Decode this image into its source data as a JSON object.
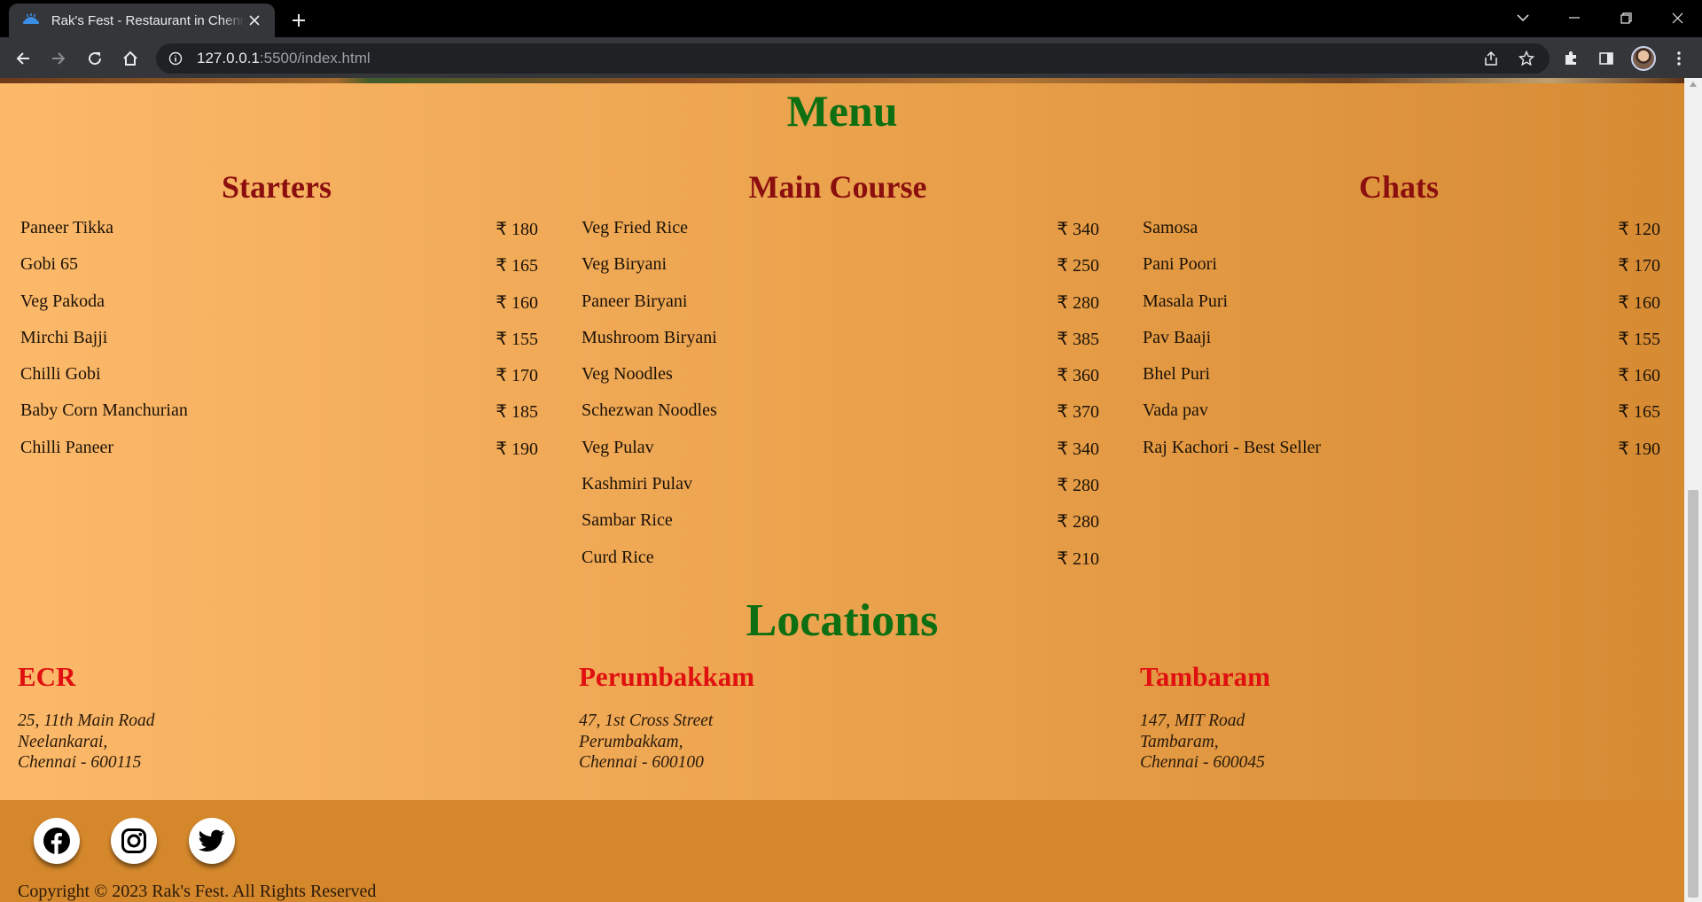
{
  "browser": {
    "tab_title": "Rak's Fest - Restaurant in Chennai",
    "url_host": "127.0.0.1",
    "url_rest": ":5500/index.html"
  },
  "menu": {
    "title": "Menu",
    "columns": [
      {
        "title": "Starters",
        "items": [
          {
            "name": "Paneer Tikka",
            "price": "₹ 180"
          },
          {
            "name": "Gobi 65",
            "price": "₹ 165"
          },
          {
            "name": "Veg Pakoda",
            "price": "₹ 160"
          },
          {
            "name": "Mirchi Bajji",
            "price": "₹ 155"
          },
          {
            "name": "Chilli Gobi",
            "price": "₹ 170"
          },
          {
            "name": "Baby Corn Manchurian",
            "price": "₹ 185"
          },
          {
            "name": "Chilli Paneer",
            "price": "₹ 190"
          }
        ]
      },
      {
        "title": "Main Course",
        "items": [
          {
            "name": "Veg Fried Rice",
            "price": "₹ 340"
          },
          {
            "name": "Veg Biryani",
            "price": "₹ 250"
          },
          {
            "name": "Paneer Biryani",
            "price": "₹ 280"
          },
          {
            "name": "Mushroom Biryani",
            "price": "₹ 385"
          },
          {
            "name": "Veg Noodles",
            "price": "₹ 360"
          },
          {
            "name": "Schezwan Noodles",
            "price": "₹ 370"
          },
          {
            "name": "Veg Pulav",
            "price": "₹ 340"
          },
          {
            "name": "Kashmiri Pulav",
            "price": "₹ 280"
          },
          {
            "name": "Sambar Rice",
            "price": "₹ 280"
          },
          {
            "name": "Curd Rice",
            "price": "₹ 210"
          }
        ]
      },
      {
        "title": "Chats",
        "items": [
          {
            "name": "Samosa",
            "price": "₹ 120"
          },
          {
            "name": "Pani Poori",
            "price": "₹ 170"
          },
          {
            "name": "Masala Puri",
            "price": "₹ 160"
          },
          {
            "name": "Pav Baaji",
            "price": "₹ 155"
          },
          {
            "name": "Bhel Puri",
            "price": "₹ 160"
          },
          {
            "name": "Vada pav",
            "price": "₹ 165"
          },
          {
            "name": "Raj Kachori - Best Seller",
            "price": "₹ 190"
          }
        ]
      }
    ]
  },
  "locations": {
    "title": "Locations",
    "items": [
      {
        "name": "ECR",
        "line1": "25, 11th Main Road",
        "line2": "Neelankarai,",
        "line3": "Chennai - 600115"
      },
      {
        "name": "Perumbakkam",
        "line1": "47, 1st Cross Street",
        "line2": "Perumbakkam,",
        "line3": "Chennai - 600100"
      },
      {
        "name": "Tambaram",
        "line1": "147, MIT Road",
        "line2": "Tambaram,",
        "line3": "Chennai - 600045"
      }
    ]
  },
  "footer": {
    "social_icons": [
      "facebook-icon",
      "instagram-icon",
      "twitter-icon"
    ],
    "copyright": "Copyright © 2023 Rak's Fest. All Rights Reserved"
  },
  "colors": {
    "heading_green": "#0e6e12",
    "subheading_maroon": "#8c0f0f",
    "location_red": "#e01010",
    "footer_bg": "#d4872b"
  }
}
